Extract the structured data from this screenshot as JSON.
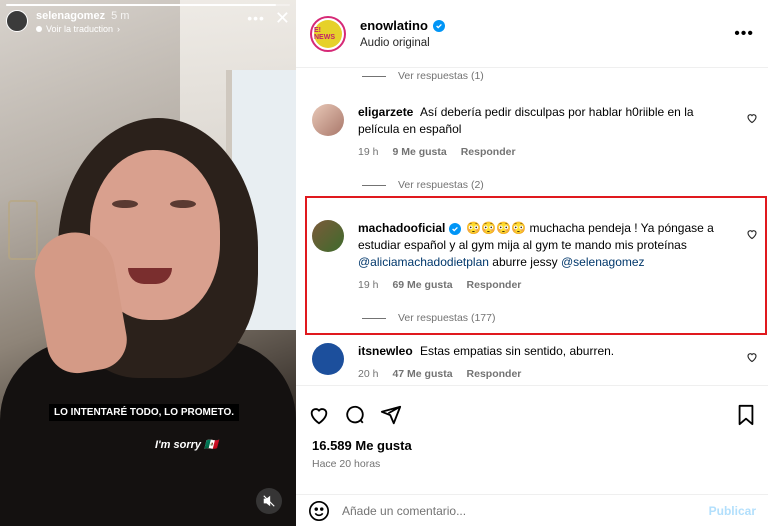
{
  "story": {
    "username": "selenagomez",
    "time": "5 m",
    "translate": "Voir la traduction",
    "caption_main": "LO INTENTARÉ TODO, LO PROMETO.",
    "caption_secondary": "I'm sorry 🇲🇽",
    "progress": 0.95
  },
  "post": {
    "account": "enowlatino",
    "audio": "Audio original",
    "brand_mark": "E! NEWS"
  },
  "comments": {
    "replies_top": "Ver respuestas (1)",
    "items": [
      {
        "user": "eligarzete",
        "text": "Así debería pedir disculpas por hablar h0riible en la película en español",
        "time": "19 h",
        "likes": "9 Me gusta",
        "reply": "Responder",
        "replies": "Ver respuestas (2)"
      },
      {
        "user": "machadooficial",
        "text_main": "😳😳😳😳 muchacha pendeja ! Ya póngase a estudiar español y al gym mija al gym te mando mis proteínas",
        "mention1": "@aliciamachadodietplan",
        "text_mid": "aburre jessy",
        "mention2": "@selenagomez",
        "time": "19 h",
        "likes": "69 Me gusta",
        "reply": "Responder",
        "replies": "Ver respuestas (177)"
      },
      {
        "user": "itsnewleo",
        "text": "Estas empatias sin sentido, aburren.",
        "time": "20 h",
        "likes": "47 Me gusta",
        "reply": "Responder"
      }
    ]
  },
  "footer": {
    "likes": "16.589 Me gusta",
    "date": "Hace 20 horas",
    "comment_placeholder": "Añade un comentario...",
    "publish": "Publicar"
  },
  "colors": {
    "highlight": "#e0191e",
    "verified": "#0095f6",
    "mention": "#00376b",
    "publish_disabled": "#b2dffc"
  }
}
